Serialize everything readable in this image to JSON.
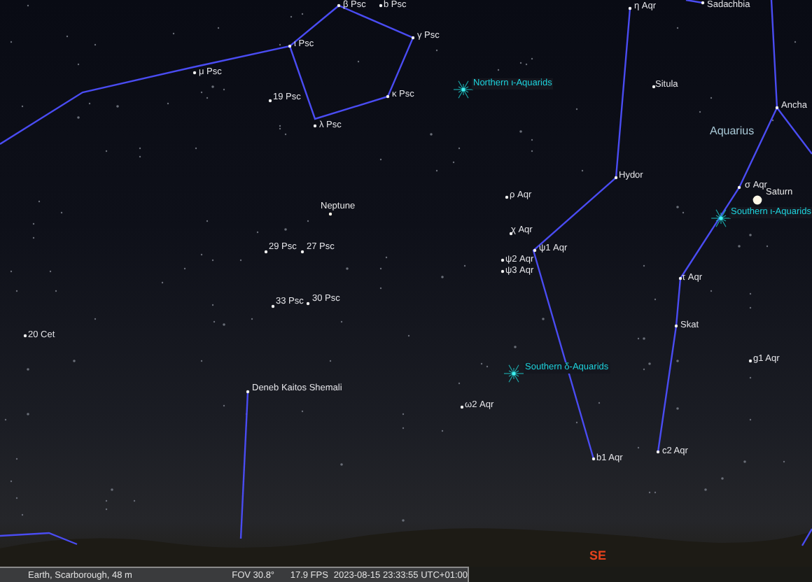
{
  "sky_labels": [
    {
      "kind": "star",
      "text": "β Psc"
    },
    {
      "kind": "star",
      "text": "b Psc"
    },
    {
      "kind": "star",
      "text": "γ Psc"
    },
    {
      "kind": "star",
      "text": "ι Psc"
    },
    {
      "kind": "star",
      "text": "μ Psc"
    },
    {
      "kind": "star",
      "text": "19 Psc"
    },
    {
      "kind": "star",
      "text": "κ Psc"
    },
    {
      "kind": "star",
      "text": "λ Psc"
    },
    {
      "kind": "meteor-shower",
      "text": "Northern ι-Aquarids"
    },
    {
      "kind": "star",
      "text": "η Aqr"
    },
    {
      "kind": "star",
      "text": "Sadachbia"
    },
    {
      "kind": "star",
      "text": "Situla"
    },
    {
      "kind": "star",
      "text": "Ancha"
    },
    {
      "kind": "constellation",
      "text": "Aquarius"
    },
    {
      "kind": "star",
      "text": "Hydor"
    },
    {
      "kind": "star",
      "text": "ρ Aqr"
    },
    {
      "kind": "star",
      "text": "σ Aqr"
    },
    {
      "kind": "planet",
      "text": "Saturn"
    },
    {
      "kind": "meteor-shower",
      "text": "Southern ι-Aquarids"
    },
    {
      "kind": "planet",
      "text": "Neptune"
    },
    {
      "kind": "star",
      "text": "χ Aqr"
    },
    {
      "kind": "star",
      "text": "ψ1 Aqr"
    },
    {
      "kind": "star",
      "text": "ψ2 Aqr"
    },
    {
      "kind": "star",
      "text": "ψ3 Aqr"
    },
    {
      "kind": "star",
      "text": "29 Psc"
    },
    {
      "kind": "star",
      "text": "27 Psc"
    },
    {
      "kind": "star",
      "text": "33 Psc"
    },
    {
      "kind": "star",
      "text": "30 Psc"
    },
    {
      "kind": "star",
      "text": "τ Aqr"
    },
    {
      "kind": "star",
      "text": "Skat"
    },
    {
      "kind": "star",
      "text": "20 Cet"
    },
    {
      "kind": "meteor-shower",
      "text": "Southern δ-Aquarids"
    },
    {
      "kind": "star",
      "text": "g1 Aqr"
    },
    {
      "kind": "star",
      "text": "Deneb Kaitos Shemali"
    },
    {
      "kind": "star",
      "text": "ω2 Aqr"
    },
    {
      "kind": "star",
      "text": "b1 Aqr"
    },
    {
      "kind": "star",
      "text": "c2 Aqr"
    }
  ],
  "cardinal_point": {
    "text": "SE"
  },
  "status_bar": {
    "location": "Earth, Scarborough, 48 m",
    "fov": "FOV 30.8°",
    "fps": "17.9 FPS",
    "datetime": "2023-08-15 23:33:55 UTC+01:00"
  }
}
